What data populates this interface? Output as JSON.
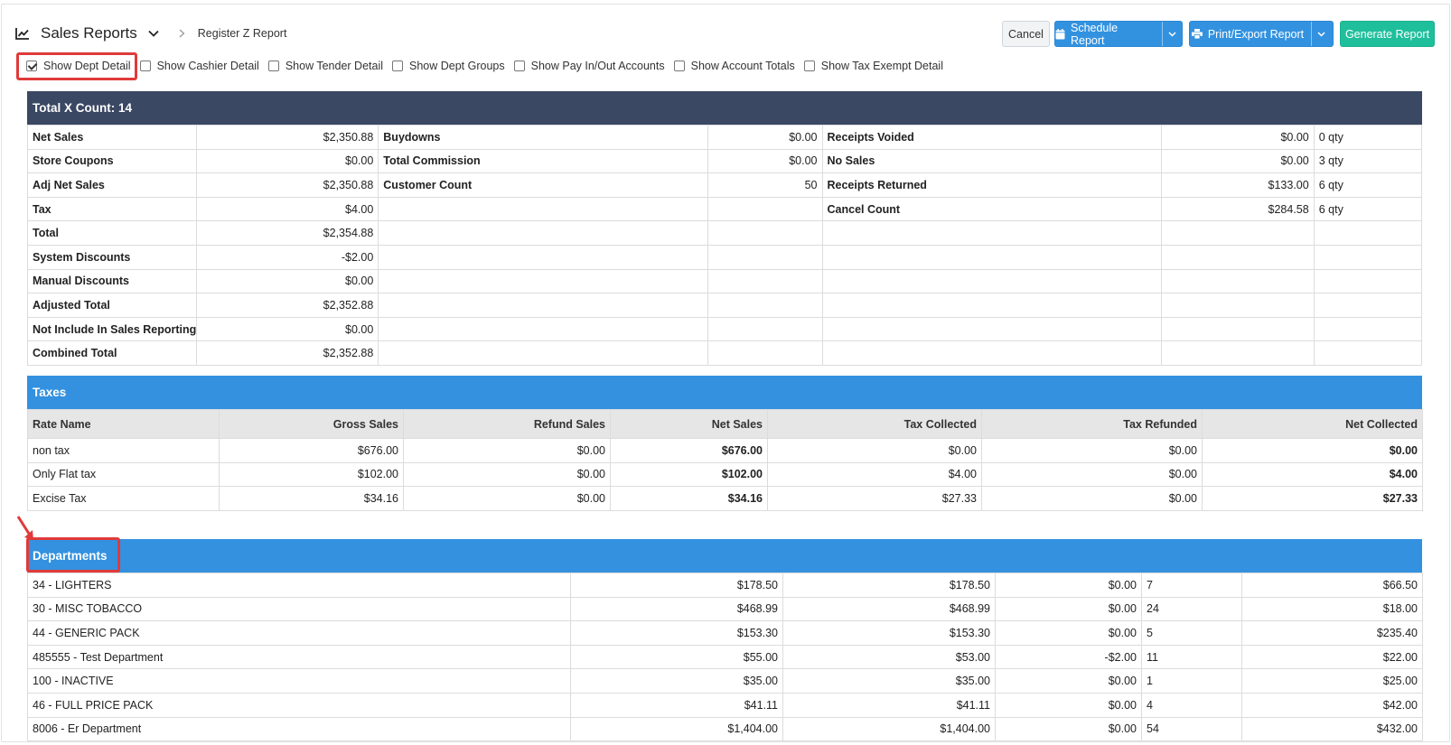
{
  "header": {
    "title": "Sales Reports",
    "breadcrumb": "Register Z Report",
    "buttons": {
      "cancel": "Cancel",
      "schedule": "Schedule Report",
      "print": "Print/Export Report",
      "generate": "Generate Report"
    }
  },
  "options": [
    {
      "label": "Show Dept Detail",
      "checked": true
    },
    {
      "label": "Show Cashier Detail",
      "checked": false
    },
    {
      "label": "Show Tender Detail",
      "checked": false
    },
    {
      "label": "Show Dept Groups",
      "checked": false
    },
    {
      "label": "Show Pay In/Out Accounts",
      "checked": false
    },
    {
      "label": "Show Account Totals",
      "checked": false
    },
    {
      "label": "Show Tax Exempt Detail",
      "checked": false
    }
  ],
  "summary": {
    "title": "Total X Count: 14",
    "rows": [
      [
        "Net Sales",
        "$2,350.88",
        "Buydowns",
        "$0.00",
        "Receipts Voided",
        "$0.00",
        "0 qty"
      ],
      [
        "Store Coupons",
        "$0.00",
        "Total Commission",
        "$0.00",
        "No Sales",
        "$0.00",
        "3 qty"
      ],
      [
        "Adj Net Sales",
        "$2,350.88",
        "Customer Count",
        "50",
        "Receipts Returned",
        "$133.00",
        "6 qty"
      ],
      [
        "Tax",
        "$4.00",
        "",
        "",
        "Cancel Count",
        "$284.58",
        "6 qty"
      ],
      [
        "Total",
        "$2,354.88",
        "",
        "",
        "",
        "",
        ""
      ],
      [
        "System Discounts",
        "-$2.00",
        "",
        "",
        "",
        "",
        ""
      ],
      [
        "Manual Discounts",
        "$0.00",
        "",
        "",
        "",
        "",
        ""
      ],
      [
        "Adjusted Total",
        "$2,352.88",
        "",
        "",
        "",
        "",
        ""
      ],
      [
        "Not Include In Sales Reporting",
        "$0.00",
        "",
        "",
        "",
        "",
        ""
      ],
      [
        "Combined Total",
        "$2,352.88",
        "",
        "",
        "",
        "",
        ""
      ]
    ]
  },
  "taxes": {
    "title": "Taxes",
    "columns": [
      "Rate Name",
      "Gross Sales",
      "Refund Sales",
      "Net Sales",
      "Tax Collected",
      "Tax Refunded",
      "Net Collected"
    ],
    "rows": [
      [
        "non tax",
        "$676.00",
        "$0.00",
        "$676.00",
        "$0.00",
        "$0.00",
        "$0.00"
      ],
      [
        "Only Flat tax",
        "$102.00",
        "$0.00",
        "$102.00",
        "$4.00",
        "$0.00",
        "$4.00"
      ],
      [
        "Excise Tax",
        "$34.16",
        "$0.00",
        "$34.16",
        "$27.33",
        "$0.00",
        "$27.33"
      ]
    ]
  },
  "departments": {
    "title": "Departments",
    "rows": [
      [
        "34 - LIGHTERS",
        "$178.50",
        "$178.50",
        "$0.00",
        "7",
        "$66.50"
      ],
      [
        "30 - MISC TOBACCO",
        "$468.99",
        "$468.99",
        "$0.00",
        "24",
        "$18.00"
      ],
      [
        "44 - GENERIC PACK",
        "$153.30",
        "$153.30",
        "$0.00",
        "5",
        "$235.40"
      ],
      [
        "485555 - Test Department",
        "$55.00",
        "$53.00",
        "-$2.00",
        "11",
        "$22.00"
      ],
      [
        "100 - INACTIVE",
        "$35.00",
        "$35.00",
        "$0.00",
        "1",
        "$25.00"
      ],
      [
        "46 - FULL PRICE PACK",
        "$41.11",
        "$41.11",
        "$0.00",
        "4",
        "$42.00"
      ],
      [
        "8006 - Er Department",
        "$1,404.00",
        "$1,404.00",
        "$0.00",
        "54",
        "$432.00"
      ]
    ]
  },
  "colors": {
    "dark_header": "#3a4863",
    "blue_header": "#3391e0",
    "button_blue": "#3392e0",
    "button_green": "#1fbf9c",
    "highlight_red": "#e03a3a"
  }
}
